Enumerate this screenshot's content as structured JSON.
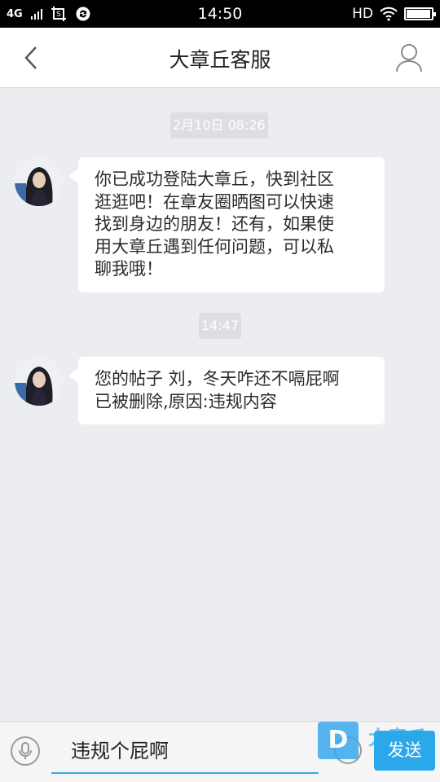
{
  "status_bar": {
    "network": "4G",
    "time": "14:50",
    "hd": "HD",
    "battery_level": 0.95,
    "icons": [
      "signal-bars-icon",
      "screenshot-icon",
      "sync-icon",
      "wifi-icon",
      "battery-icon"
    ]
  },
  "header": {
    "title": "大章丘客服",
    "back_icon": "chevron-left-icon",
    "profile_icon": "person-icon"
  },
  "messages": [
    {
      "timestamp": "2月10日 08:26",
      "lines": [
        "你已成功登陆大章丘，快到社区",
        "逛逛吧！在章友圈晒图可以快速",
        "找到身边的朋友！还有，如果使",
        "用大章丘遇到任何问题，可以私",
        "聊我哦！"
      ]
    },
    {
      "timestamp": "14:47",
      "lines": [
        "您的帖子 刘，冬天咋还不嗝屁啊",
        "已被删除,原因:违规内容"
      ]
    }
  ],
  "composer": {
    "mic_icon": "microphone-icon",
    "input_value": "违规个屁啊",
    "emoji_icon": "emoji-icon",
    "send_label": "发送",
    "watermark_logo": "D",
    "watermark_text": "大章丘"
  },
  "colors": {
    "background": "#ebedf1",
    "accent": "#2aa8ea",
    "timestamp_bg": "#dcdee2"
  }
}
